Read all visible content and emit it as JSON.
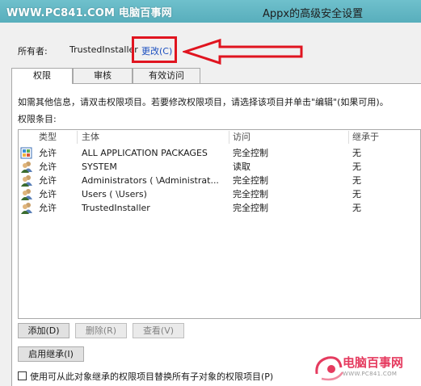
{
  "window": {
    "title": "Appx的高级安全设置",
    "watermark": "WWW.PC841.COM 电脑百事网"
  },
  "owner": {
    "label": "所有者:",
    "name": "TrustedInstaller",
    "change_link": "更改(C)"
  },
  "tabs": [
    {
      "label": "权限",
      "active": true
    },
    {
      "label": "审核",
      "active": false
    },
    {
      "label": "有效访问",
      "active": false
    }
  ],
  "info_text": "如需其他信息，请双击权限项目。若要修改权限项目，请选择该项目并单击\"编辑\"(如果可用)。",
  "entries_label": "权限条目:",
  "columns": [
    "类型",
    "主体",
    "访问",
    "继承于"
  ],
  "rows": [
    {
      "type": "允许",
      "principal": "ALL APPLICATION PACKAGES",
      "access": "完全控制",
      "inherited": "无",
      "icon": "package-group-icon"
    },
    {
      "type": "允许",
      "principal": "SYSTEM",
      "access": "读取",
      "inherited": "无",
      "icon": "user-group-icon"
    },
    {
      "type": "允许",
      "principal": "Administrators (      \\Administrat...",
      "access": "完全控制",
      "inherited": "无",
      "icon": "user-group-icon"
    },
    {
      "type": "允许",
      "principal": "Users (      \\Users)",
      "access": "完全控制",
      "inherited": "无",
      "icon": "user-group-icon"
    },
    {
      "type": "允许",
      "principal": "TrustedInstaller",
      "access": "完全控制",
      "inherited": "无",
      "icon": "user-group-icon"
    }
  ],
  "buttons": {
    "add": "添加(D)",
    "remove": "删除(R)",
    "view": "查看(V)",
    "enable_inheritance": "启用继承(I)"
  },
  "replace_checkbox": {
    "label": "使用可从此对象继承的权限项目替换所有子对象的权限项目(P)",
    "checked": false
  },
  "brand": {
    "name": "电脑百事网",
    "url": "WWW.PC841.COM"
  },
  "colors": {
    "highlight": "#e0141f",
    "link": "#1a4fbf",
    "titlebar": "#62b6c3",
    "logo": "#e53b5f"
  }
}
